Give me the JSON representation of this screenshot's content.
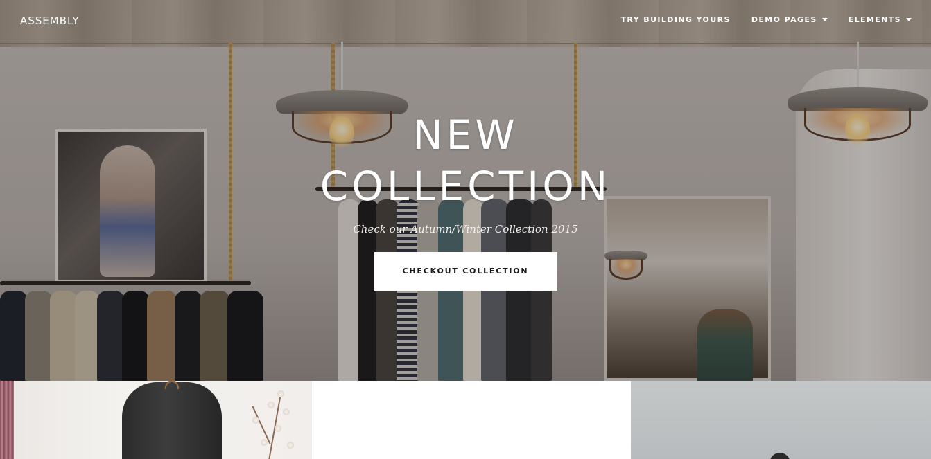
{
  "brand": "ASSEMBLY",
  "nav": {
    "items": [
      {
        "label": "TRY BUILDING YOURS",
        "dropdown": false
      },
      {
        "label": "DEMO PAGES",
        "dropdown": true
      },
      {
        "label": "ELEMENTS",
        "dropdown": true
      }
    ]
  },
  "hero": {
    "title_line1": "NEW",
    "title_line2": "COLLECTION",
    "subtitle": "Check our Autumn/Winter Collection 2015",
    "button_label": "CHECKOUT COLLECTION"
  },
  "colors": {
    "text_light": "#ffffff",
    "button_bg": "#ffffff",
    "button_text": "#1a1a1a"
  },
  "icons": {
    "dropdown": "caret-down-icon"
  }
}
